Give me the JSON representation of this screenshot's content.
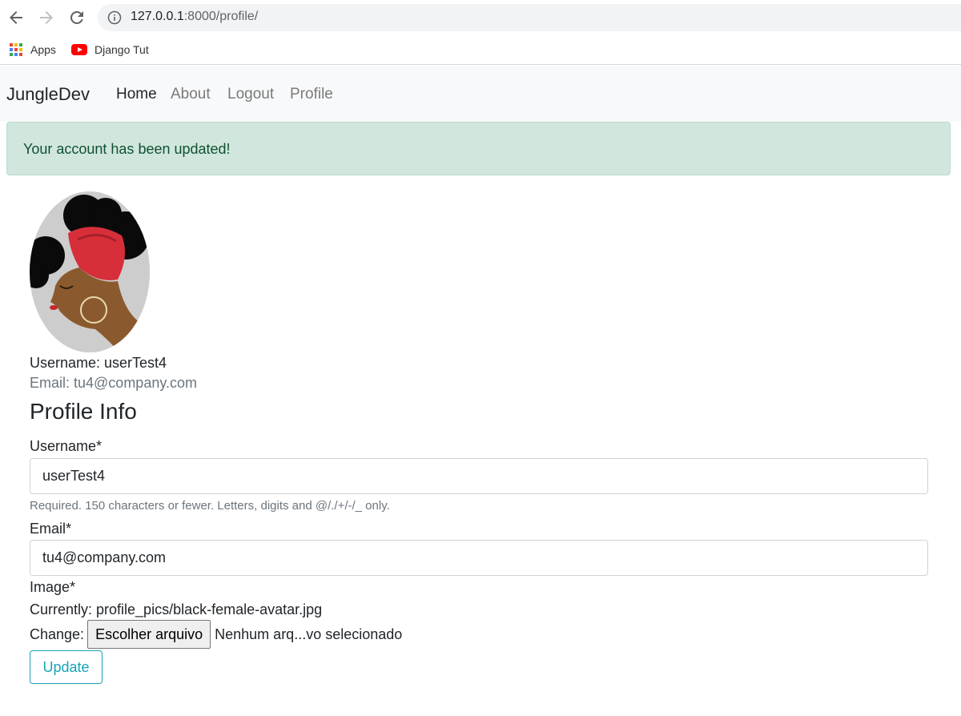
{
  "browser": {
    "url_host": "127.0.0.1",
    "url_rest": ":8000/profile/",
    "bookmarks": [
      {
        "label": "Apps",
        "icon": "apps-grid-icon"
      },
      {
        "label": "Django Tut",
        "icon": "youtube-icon"
      }
    ]
  },
  "navbar": {
    "brand": "JungleDev",
    "links": [
      {
        "label": "Home",
        "active": true
      },
      {
        "label": "About",
        "active": false
      },
      {
        "label": "Logout",
        "active": false
      },
      {
        "label": "Profile",
        "active": false
      }
    ]
  },
  "alert": {
    "message": "Your account has been updated!",
    "color": "#d1e7dd",
    "text_color": "#0f5132"
  },
  "profile": {
    "username_line": "Username: userTest4",
    "email_line": "Email: tu4@company.com",
    "avatar_icon": "female-avatar-icon"
  },
  "form": {
    "legend": "Profile Info",
    "username": {
      "label": "Username*",
      "value": "userTest4",
      "help": "Required. 150 characters or fewer. Letters, digits and @/./+/-/_ only."
    },
    "email": {
      "label": "Email*",
      "value": "tu4@company.com"
    },
    "image": {
      "label": "Image*",
      "currently": "Currently: profile_pics/black-female-avatar.jpg",
      "change_label": "Change:",
      "choose_button": "Escolher arquivo",
      "file_status": "Nenhum arq...vo selecionado"
    },
    "submit": "Update",
    "accent": "#17a2b8"
  }
}
